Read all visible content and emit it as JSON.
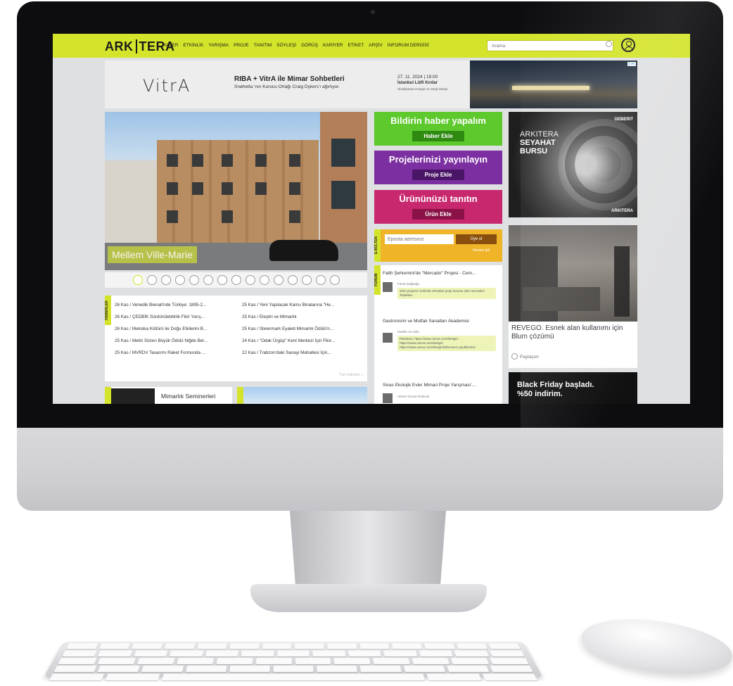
{
  "site": {
    "logo": "ARKITERA",
    "logo_left": "ARK",
    "logo_right": "TERA",
    "nav": [
      "HABER",
      "ETKİNLİK",
      "YARIŞMA",
      "PROJE",
      "TANITIM",
      "SÖYLEŞİ",
      "GÖRÜŞ",
      "KARİYER",
      "ETİKET",
      "ARŞİV",
      "İNFORUM DERGİSİ"
    ],
    "search_placeholder": "Arama",
    "accent": "#d4e42a"
  },
  "banner": {
    "brand": "VitrA",
    "title": "RIBA + VitrA ile Mimar Sohbetleri",
    "subtitle": "Snøhetta 'nın Kurucu Ortağı Craig Dykers'ı ağırlıyor.",
    "date": "27. 11. 2024 | 19:00",
    "place": "İstanbul Lütfi Kırdar",
    "place_detail": "Uluslararası Kongre ve Sergi Sarayı"
  },
  "slider": {
    "caption": "Mellem Ville-Marie",
    "dot_count": 15,
    "active_index": 0
  },
  "news": {
    "tag": "HABERLER",
    "left": [
      "26 Kas / Venedik Bienali'nde Türkiye: 1895-2...",
      "26 Kas / ÇEDBİK Sürdürülebilirlik Fikir Yarış...",
      "26 Kas / Meksika Kültürü ile Doğu Etkilerini B...",
      "25 Kas / Metin Sözen Büyük Ödülü Niğde Bel...",
      "25 Kas / MVRDV Tasarımı Raket Formunda ..."
    ],
    "right": [
      "25 Kas / Yeni Yapılacak Kamu Binalarına \"He...",
      "25 Kas / Eleştiri ve Mimarlık",
      "25 Kas / Steiermark Eyaleti Mimarlık Ödülü'n...",
      "24 Kas / \"Odak Ürgüp\" Kent Merkezi İçin Fikir...",
      "22 Kas / Trabzon'daki Sanayi Mahallesi İçin..."
    ],
    "more": "Tüm haberler »"
  },
  "tiles": {
    "seminar": "Mimarlık Seminerleri"
  },
  "cta": [
    {
      "title": "Bildirin haber yapalım",
      "button": "Haber Ekle",
      "bg": "#5ec92d",
      "btn_bg": "#2f8a12"
    },
    {
      "title": "Projelerinizi yayınlayın",
      "button": "Proje Ekle",
      "bg": "#7b2fa0",
      "btn_bg": "#4a1566"
    },
    {
      "title": "Ürününüzü tanıtın",
      "button": "Ürün Ekle",
      "bg": "#c8286e",
      "btn_bg": "#8a1246"
    }
  ],
  "newsletter": {
    "tag": "E-BÜLTEN",
    "placeholder": "Eposta adresiniz",
    "button": "Üye ol",
    "link": "Hemen gör"
  },
  "forum": {
    "tag": "FORUM",
    "threads": [
      {
        "title": "Fatih Şehremini'de \"Mercado\" Projesi - Cem...",
        "user": "Faruk Doğdoğu",
        "text": "Sizin projeniz özelinde olmadan proje konusu olan mercado? Teşekkür..."
      },
      {
        "title": "Gastronomi ve Mutfak Sanatları Akademisi",
        "user": "Hasibe ve Gülü",
        "text": "Planlama: https://www.canva.com/design/ https://www.canva.com/design/ https://www.canva.com/design/fullscreen/ yayıbilirsiniz."
      },
      {
        "title": "Sivas Ekolojik Evler Mimari Proje Yarışması'...",
        "user": "Ahmet Tuncer Rızkıcık",
        "text": ""
      }
    ]
  },
  "ads": {
    "geberit_brand": "GEBERIT",
    "geberit_t1": "ARKITERA",
    "geberit_t2": "SEYAHAT",
    "geberit_t3": "BURSU",
    "geberit_logo": "ARKITERA",
    "blum_title": "REVEGO. Esnek alan kullanımı için Blum çözümü",
    "blum_share": "Paylaşım",
    "bf_line1": "Black Friday başladı.",
    "bf_line2": "%50 indirim."
  }
}
